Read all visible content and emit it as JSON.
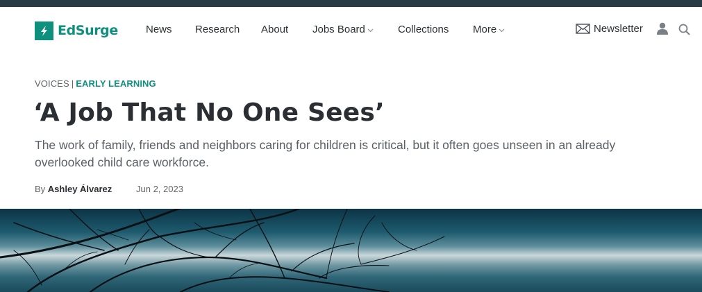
{
  "header": {
    "logo_text": "EdSurge",
    "menu": [
      {
        "label": "News",
        "has_dropdown": false
      },
      {
        "label": "Research",
        "has_dropdown": false
      },
      {
        "label": "About",
        "has_dropdown": false
      },
      {
        "label": "Jobs Board",
        "has_dropdown": true
      },
      {
        "label": "Collections",
        "has_dropdown": false
      },
      {
        "label": "More",
        "has_dropdown": true
      }
    ],
    "newsletter_label": "Newsletter",
    "icons": [
      "envelope-icon",
      "user-icon",
      "search-icon",
      "chevron-down-icon"
    ]
  },
  "article": {
    "section": "VOICES",
    "separator": "|",
    "category": "EARLY LEARNING",
    "title": "‘A Job That No One Sees’",
    "dek": "The work of family, friends and neighbors caring for children is critical, but it often goes unseen in an already overlooked child care workforce.",
    "byline_prefix": "By",
    "author": "Ashley Álvarez",
    "date": "Jun 2, 2023"
  },
  "colors": {
    "brand": "#0f8f7e",
    "topbar": "#283b45",
    "text": "#2b2f33",
    "muted": "#5f6468"
  }
}
